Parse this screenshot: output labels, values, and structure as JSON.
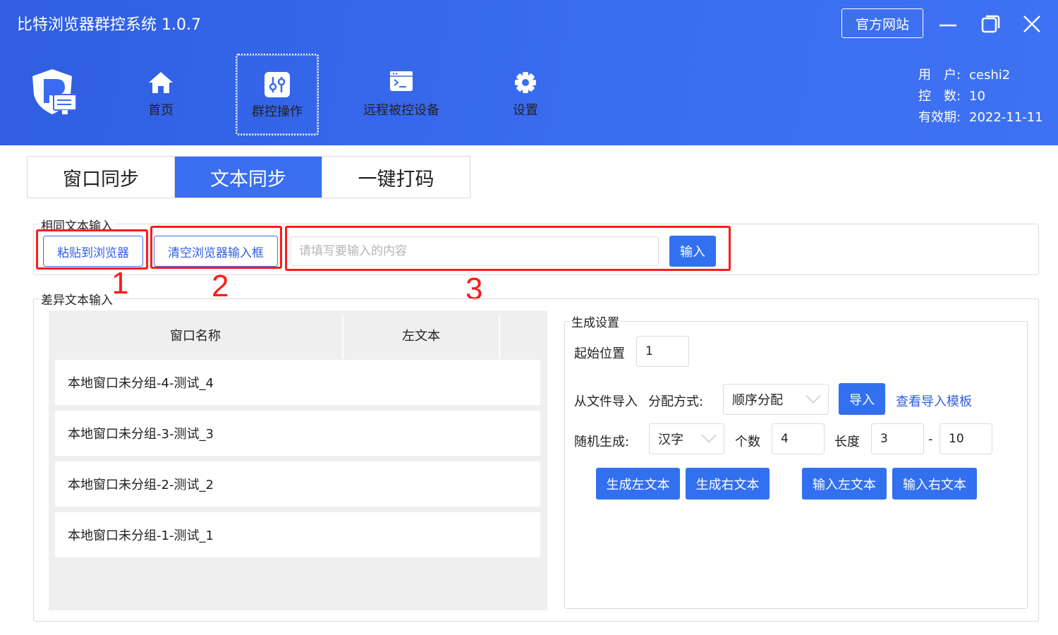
{
  "app": {
    "title": "比特浏览器群控系统 1.0.7",
    "site_button": "官方网站"
  },
  "nav": [
    {
      "label": "首页",
      "icon": "home-icon"
    },
    {
      "label": "群控操作",
      "icon": "sliders-icon"
    },
    {
      "label": "远程被控设备",
      "icon": "terminal-icon"
    },
    {
      "label": "设置",
      "icon": "gear-icon"
    }
  ],
  "user": {
    "user_key": "用　户:",
    "user_val": "ceshi2",
    "ctrl_key": "控　数:",
    "ctrl_val": "10",
    "valid_key": "有效期:",
    "valid_val": "2022-11-11"
  },
  "tabs": [
    "窗口同步",
    "文本同步",
    "一键打码"
  ],
  "same_text": {
    "title": "相同文本输入",
    "paste_button": "粘贴到浏览器",
    "clear_button": "清空浏览器输入框",
    "input_placeholder": "请填写要输入的内容",
    "input_value": "",
    "submit_button": "输入"
  },
  "annotations": [
    "1",
    "2",
    "3"
  ],
  "diff_text": {
    "title": "差异文本输入",
    "columns": [
      "窗口名称",
      "左文本"
    ],
    "rows": [
      "本地窗口未分组-4-测试_4",
      "本地窗口未分组-3-测试_3",
      "本地窗口未分组-2-测试_2",
      "本地窗口未分组-1-测试_1"
    ]
  },
  "gen": {
    "title": "生成设置",
    "start_label": "起始位置",
    "start_value": "1",
    "import_label": "从文件导入",
    "assign_label": "分配方式:",
    "assign_value": "顺序分配",
    "import_button": "导入",
    "template_link": "查看导入模板",
    "random_label": "随机生成:",
    "random_type": "汉字",
    "count_label": "个数",
    "count_value": "4",
    "length_label": "长度",
    "length_min": "3",
    "length_dash": "-",
    "length_max": "10",
    "btn_gen_left": "生成左文本",
    "btn_gen_right": "生成右文本",
    "btn_in_left": "输入左文本",
    "btn_in_right": "输入右文本"
  },
  "colors": {
    "primary": "#3370f0",
    "header": "#3a6cf0",
    "annotation": "#ff1a1a"
  }
}
